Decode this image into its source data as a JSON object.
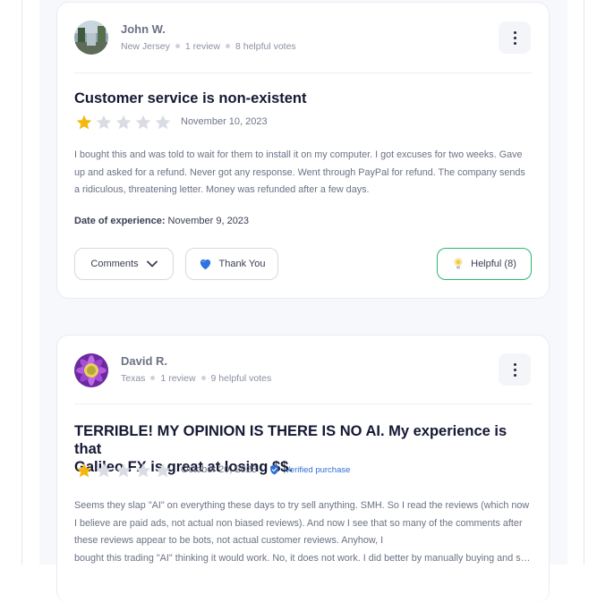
{
  "reviews": [
    {
      "author": "John W.",
      "location": "New Jersey",
      "review_count": "1 review",
      "helpful_votes": "8 helpful votes",
      "title": "Customer service is non-existent",
      "rating": 1,
      "rating_max": 5,
      "date": "November 10, 2023",
      "body": "I bought this and was told to wait for them to install it on my computer. I got excuses for two weeks. Gave up and asked for a refund. Never got any response. Went through PayPal for refund. The company sends a ridiculous, threatening letter. Money was refunded after a few days.",
      "experience_label": "Date of experience:",
      "experience_date": "November 9, 2023",
      "comments_label": "Comments",
      "thanks_label": "Thank You",
      "helpful_label": "Helpful (8)"
    },
    {
      "author": "David R.",
      "location": "Texas",
      "review_count": "1 review",
      "helpful_votes": "9 helpful votes",
      "title_line1": "TERRIBLE! MY OPINION IS THERE IS NO AI. My experience is that",
      "title_line2": "Galileo FX is great at losing $$.",
      "rating": 1,
      "rating_max": 5,
      "date": "October 20, 2023",
      "verified_label": "Verified purchase",
      "body_main": "Seems they slap \"AI\" on everything these days to try sell anything. SMH. So I read the reviews (which now I believe are paid ads, not actual non biased reviews). And now I see that so many of the comments after these reviews appear to be bots, not actual customer reviews. Anyhow, I",
      "body_last": "bought this trading \"AI\" thinking it would work. No, it does not work. I did better by manually buying and selling on my own."
    }
  ],
  "colors": {
    "star_active": "#f5b70f",
    "star_inactive": "#d9dce3",
    "helpful_border": "#2bb673",
    "verified": "#2f6fd6"
  },
  "icons": [
    "more-vertical-icon",
    "chevron-down-icon",
    "blue-heart-icon",
    "lightbulb-icon",
    "verified-shield-icon",
    "star-icon"
  ]
}
